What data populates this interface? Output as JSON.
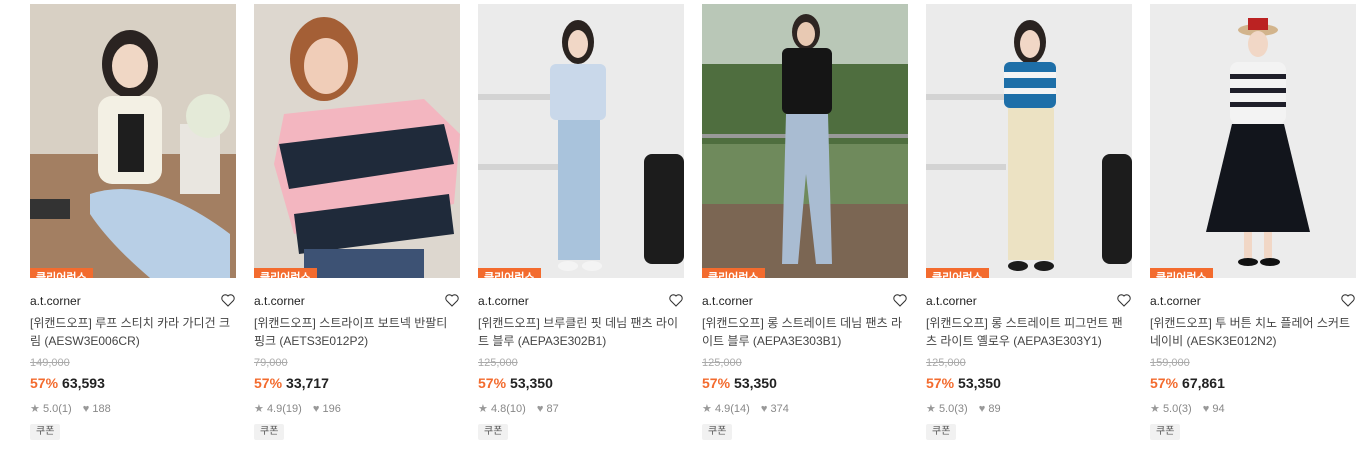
{
  "products": [
    {
      "tag": "클리어런스",
      "brand": "a.t.corner",
      "title": "[위캔드오프] 루프 스티치 카라 가디건 크림 (AESW3E006CR)",
      "original_price": "149,000",
      "discount": "57%",
      "price": "63,593",
      "rating": "5.0",
      "reviews": "(1)",
      "likes": "188",
      "coupon": "쿠폰"
    },
    {
      "tag": "클리어런스",
      "brand": "a.t.corner",
      "title": "[위캔드오프] 스트라이프 보트넥 반팔티 핑크 (AETS3E012P2)",
      "original_price": "79,000",
      "discount": "57%",
      "price": "33,717",
      "rating": "4.9",
      "reviews": "(19)",
      "likes": "196",
      "coupon": "쿠폰"
    },
    {
      "tag": "클리어런스",
      "brand": "a.t.corner",
      "title": "[위캔드오프] 브루클린 핏 데님 팬츠 라이트 블루 (AEPA3E302B1)",
      "original_price": "125,000",
      "discount": "57%",
      "price": "53,350",
      "rating": "4.8",
      "reviews": "(10)",
      "likes": "87",
      "coupon": "쿠폰"
    },
    {
      "tag": "클리어런스",
      "brand": "a.t.corner",
      "title": "[위캔드오프] 롱 스트레이트 데님 팬츠 라이트 블루 (AEPA3E303B1)",
      "original_price": "125,000",
      "discount": "57%",
      "price": "53,350",
      "rating": "4.9",
      "reviews": "(14)",
      "likes": "374",
      "coupon": "쿠폰"
    },
    {
      "tag": "클리어런스",
      "brand": "a.t.corner",
      "title": "[위캔드오프] 롱 스트레이트 피그먼트 팬츠 라이트 옐로우 (AEPA3E303Y1)",
      "original_price": "125,000",
      "discount": "57%",
      "price": "53,350",
      "rating": "5.0",
      "reviews": "(3)",
      "likes": "89",
      "coupon": "쿠폰"
    },
    {
      "tag": "클리어런스",
      "brand": "a.t.corner",
      "title": "[위캔드오프] 투 버튼 치노 플레어 스커트 네이비 (AESK3E012N2)",
      "original_price": "159,000",
      "discount": "57%",
      "price": "67,861",
      "rating": "5.0",
      "reviews": "(3)",
      "likes": "94",
      "coupon": "쿠폰"
    }
  ],
  "colors": {
    "accent": "#f36b2e",
    "coupon_bg": "#f1f1f1"
  },
  "icons": {
    "heart": "heart-outline-icon",
    "star": "star-icon",
    "like": "heart-filled-icon"
  }
}
